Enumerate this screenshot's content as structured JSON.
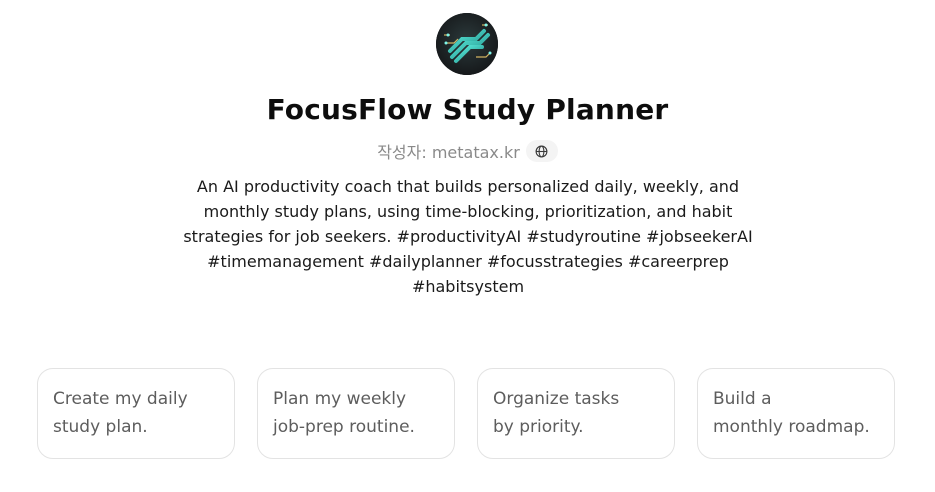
{
  "gpt": {
    "avatar_icon": "circuit-brain-avatar-icon",
    "title": "FocusFlow Study Planner",
    "author_label": "작성자: metatax.kr",
    "globe_icon": "globe-icon",
    "description": "An AI productivity coach that builds personalized daily, weekly, and monthly study plans, using time-blocking, prioritization, and habit strategies for job seekers. #productivityAI #studyroutine #jobseekerAI #timemanagement #dailyplanner #focusstrategies #careerprep #habitsystem"
  },
  "starters": [
    {
      "line1": "Create my daily",
      "line2": "study plan."
    },
    {
      "line1": "Plan my weekly",
      "line2": "job-prep routine."
    },
    {
      "line1": "Organize tasks",
      "line2": "by priority."
    },
    {
      "line1": "Build a",
      "line2": "monthly roadmap."
    }
  ],
  "colors": {
    "title": "#0d0d0d",
    "muted": "#8a8a8a",
    "card_border": "#e3e3e3",
    "card_text": "#5d5d5d",
    "avatar_accent": "#3fd0c4"
  }
}
